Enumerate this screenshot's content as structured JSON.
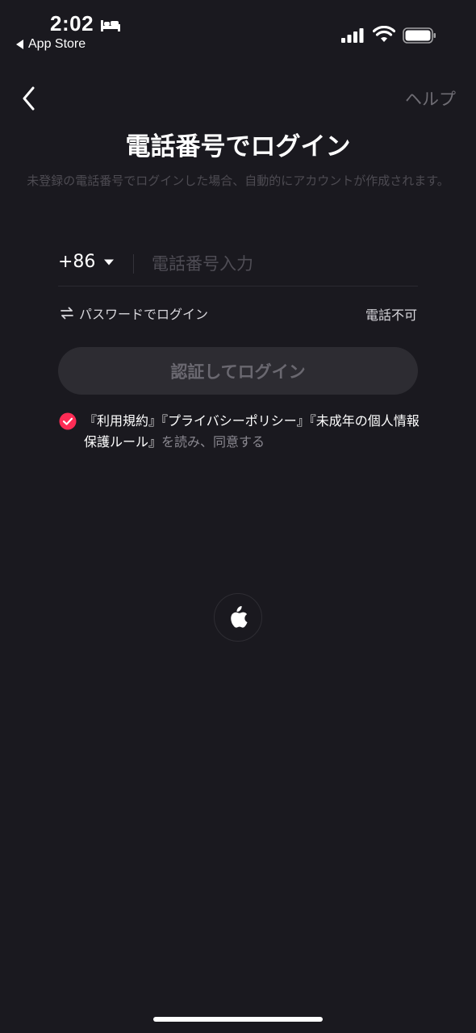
{
  "status_bar": {
    "time": "2:02",
    "back_app": "App Store"
  },
  "nav": {
    "help": "ヘルプ"
  },
  "title": "電話番号でログイン",
  "subtitle": "未登録の電話番号でログインした場合、自動的にアカウントが作成されます。",
  "phone": {
    "country_code": "+86",
    "placeholder": "電話番号入力",
    "value": ""
  },
  "options": {
    "password_login": "パスワードでログイン",
    "no_phone": "電話不可"
  },
  "login_button": "認証してログイン",
  "agreement": {
    "terms": "『利用規約』",
    "privacy": "『プライバシーポリシー』",
    "minor": "『未成年の個人情報保護ルール』",
    "suffix": "を読み、同意する",
    "checked": true
  },
  "colors": {
    "background": "#1a191f",
    "accent": "#fe2c55",
    "button_disabled": "#2d2c32"
  },
  "icons": {
    "back": "chevron-left-icon",
    "swap": "swap-arrows-icon",
    "check": "check-circle-icon",
    "apple": "apple-icon"
  }
}
